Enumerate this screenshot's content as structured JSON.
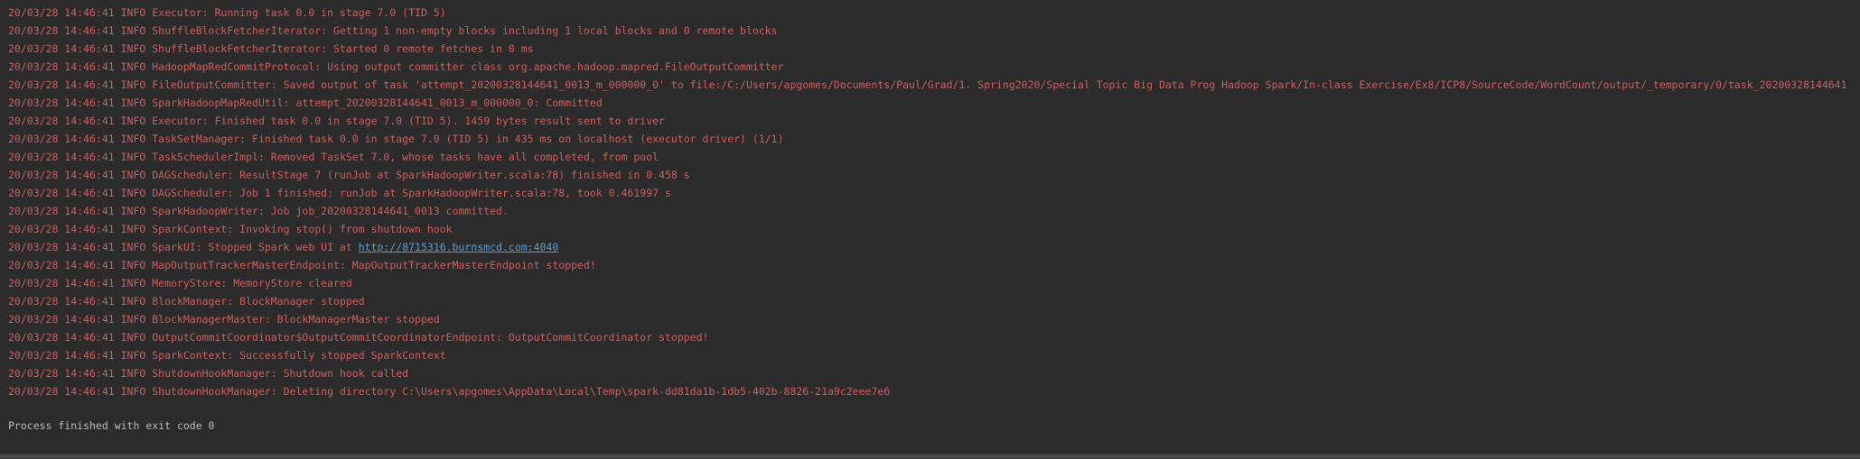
{
  "console": {
    "lines": [
      {
        "prefix": "20/03/28 14:46:41 INFO Executor: Running task 0.0 in stage 7.0 (TID 5)"
      },
      {
        "prefix": "20/03/28 14:46:41 INFO ShuffleBlockFetcherIterator: Getting 1 non-empty blocks including 1 local blocks and 0 remote blocks"
      },
      {
        "prefix": "20/03/28 14:46:41 INFO ShuffleBlockFetcherIterator: Started 0 remote fetches in 0 ms"
      },
      {
        "prefix": "20/03/28 14:46:41 INFO HadoopMapRedCommitProtocol: Using output committer class org.apache.hadoop.mapred.FileOutputCommitter"
      },
      {
        "prefix": "20/03/28 14:46:41 INFO FileOutputCommitter: Saved output of task 'attempt_20200328144641_0013_m_000000_0' to file:/C:/Users/apgomes/Documents/Paul/Grad/1. Spring2020/Special Topic Big Data Prog Hadoop Spark/In-class Exercise/Ex8/ICP8/SourceCode/WordCount/output/_temporary/0/task_20200328144641"
      },
      {
        "prefix": "20/03/28 14:46:41 INFO SparkHadoopMapRedUtil: attempt_20200328144641_0013_m_000000_0: Committed"
      },
      {
        "prefix": "20/03/28 14:46:41 INFO Executor: Finished task 0.0 in stage 7.0 (TID 5). 1459 bytes result sent to driver"
      },
      {
        "prefix": "20/03/28 14:46:41 INFO TaskSetManager: Finished task 0.0 in stage 7.0 (TID 5) in 435 ms on localhost (executor driver) (1/1)"
      },
      {
        "prefix": "20/03/28 14:46:41 INFO TaskSchedulerImpl: Removed TaskSet 7.0, whose tasks have all completed, from pool"
      },
      {
        "prefix": "20/03/28 14:46:41 INFO DAGScheduler: ResultStage 7 (runJob at SparkHadoopWriter.scala:78) finished in 0.458 s"
      },
      {
        "prefix": "20/03/28 14:46:41 INFO DAGScheduler: Job 1 finished: runJob at SparkHadoopWriter.scala:78, took 0.461997 s"
      },
      {
        "prefix": "20/03/28 14:46:41 INFO SparkHadoopWriter: Job job_20200328144641_0013 committed."
      },
      {
        "prefix": "20/03/28 14:46:41 INFO SparkContext: Invoking stop() from shutdown hook"
      },
      {
        "prefix": "20/03/28 14:46:41 INFO SparkUI: Stopped Spark web UI at ",
        "link": "http://8715316.burnsmcd.com:4040"
      },
      {
        "prefix": "20/03/28 14:46:41 INFO MapOutputTrackerMasterEndpoint: MapOutputTrackerMasterEndpoint stopped!"
      },
      {
        "prefix": "20/03/28 14:46:41 INFO MemoryStore: MemoryStore cleared"
      },
      {
        "prefix": "20/03/28 14:46:41 INFO BlockManager: BlockManager stopped"
      },
      {
        "prefix": "20/03/28 14:46:41 INFO BlockManagerMaster: BlockManagerMaster stopped"
      },
      {
        "prefix": "20/03/28 14:46:41 INFO OutputCommitCoordinator$OutputCommitCoordinatorEndpoint: OutputCommitCoordinator stopped!"
      },
      {
        "prefix": "20/03/28 14:46:41 INFO SparkContext: Successfully stopped SparkContext"
      },
      {
        "prefix": "20/03/28 14:46:41 INFO ShutdownHookManager: Shutdown hook called"
      },
      {
        "prefix": "20/03/28 14:46:41 INFO ShutdownHookManager: Deleting directory C:\\Users\\apgomes\\AppData\\Local\\Temp\\spark-dd81da1b-1db5-402b-8826-21a9c2eee7e6"
      }
    ],
    "process_status": "Process finished with exit code 0"
  },
  "colors": {
    "background": "#2b2b2b",
    "log_text": "#d35d5d",
    "link": "#5a9fd4",
    "normal_text": "#bbbbbb"
  }
}
